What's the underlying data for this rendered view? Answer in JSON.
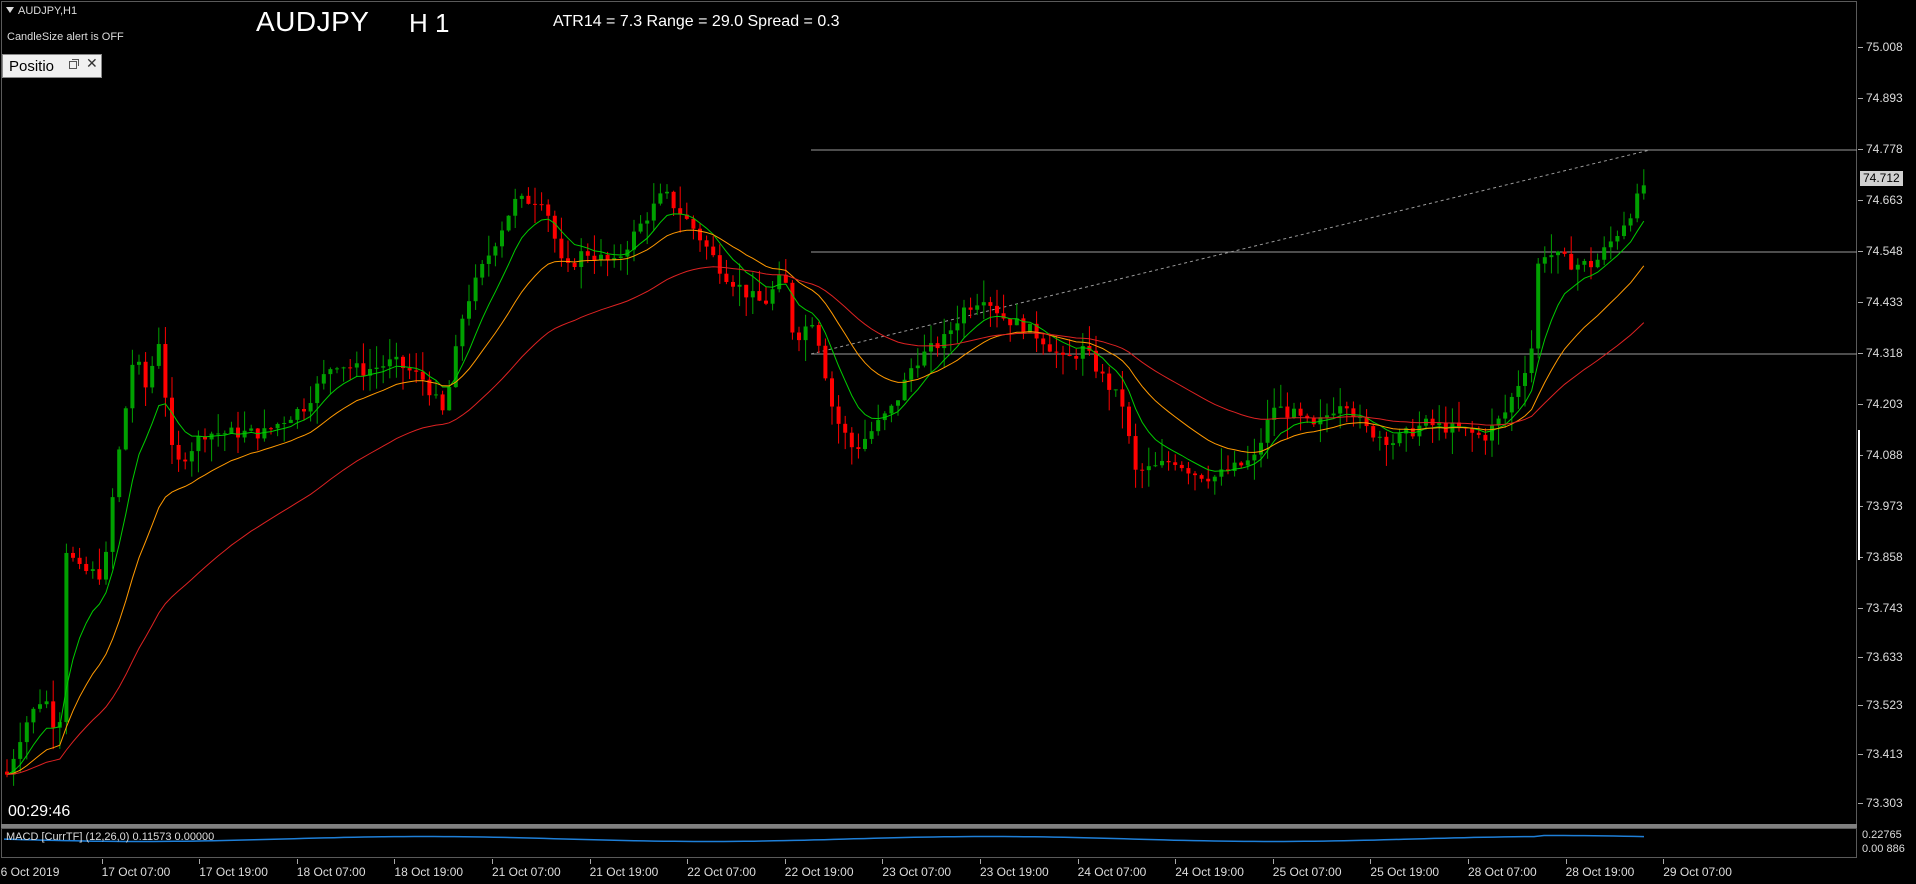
{
  "chart": {
    "symbol_label": "AUDJPY,H1",
    "alert_text": "CandleSize alert is OFF",
    "title": "AUDJPY",
    "timeframe": "H 1",
    "stats": "ATR14 = 7.3 Range = 29.0 Spread = 0.3",
    "panel_label": "Positio",
    "timer": "00:29:46",
    "current_price": "74.712",
    "macd_label": "MACD [CurrTF] (12,26,0) 0.11573 0.00000",
    "macd_value_top": "0.22765",
    "macd_value_bottom": "0.00 886",
    "y_ticks": [
      "75.008",
      "74.893",
      "74.778",
      "74.663",
      "74.548",
      "74.433",
      "74.318",
      "74.203",
      "74.088",
      "73.973",
      "73.858",
      "73.743",
      "73.633",
      "73.523",
      "73.413",
      "73.303"
    ],
    "x_ticks": [
      "16 Oct 2019",
      "17 Oct 07:00",
      "17 Oct 19:00",
      "18 Oct 07:00",
      "18 Oct 19:00",
      "21 Oct 07:00",
      "21 Oct 19:00",
      "22 Oct 07:00",
      "22 Oct 19:00",
      "23 Oct 07:00",
      "23 Oct 19:00",
      "24 Oct 07:00",
      "24 Oct 19:00",
      "25 Oct 07:00",
      "25 Oct 19:00",
      "28 Oct 07:00",
      "28 Oct 19:00",
      "29 Oct 07:00"
    ],
    "colors": {
      "bull": "#00a000",
      "bear": "#ff0000",
      "ma_fast": "#00cc00",
      "ma_mid": "#ff9900",
      "ma_slow": "#dd2222",
      "macd": "#1e7fd8"
    }
  },
  "chart_data": {
    "type": "line",
    "xlabel": "",
    "ylabel": "",
    "ylim": [
      73.25,
      75.06
    ],
    "categories": [
      "16 Oct 2019",
      "17 Oct 07:00",
      "17 Oct 19:00",
      "18 Oct 07:00",
      "18 Oct 19:00",
      "21 Oct 07:00",
      "21 Oct 19:00",
      "22 Oct 07:00",
      "22 Oct 19:00",
      "23 Oct 07:00",
      "23 Oct 19:00",
      "24 Oct 07:00",
      "24 Oct 19:00",
      "25 Oct 07:00",
      "25 Oct 19:00",
      "28 Oct 07:00",
      "28 Oct 19:00",
      "29 Oct 07:00"
    ],
    "price_close": [
      73.43,
      74.05,
      74.15,
      74.17,
      74.27,
      74.65,
      74.53,
      74.66,
      74.46,
      74.15,
      74.42,
      74.3,
      74.03,
      74.16,
      74.14,
      74.18,
      74.52,
      74.712
    ],
    "horizontal_levels": [
      74.778,
      74.548,
      74.318
    ],
    "trend_line": {
      "from": 74.318,
      "to": 74.778
    },
    "macd": {
      "value": 0.11573,
      "signal": 0.0
    }
  }
}
